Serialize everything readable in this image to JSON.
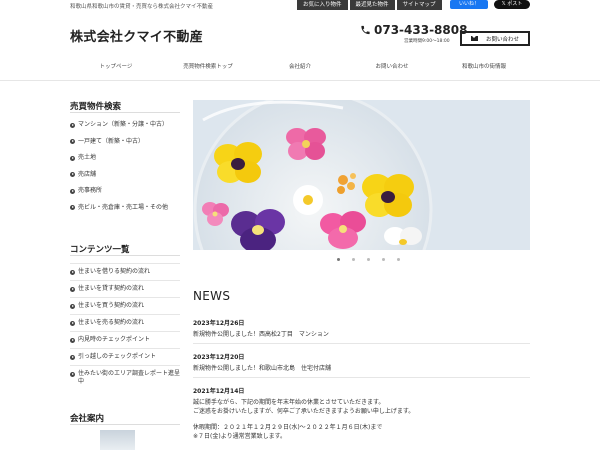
{
  "topbar": {
    "tagline": "和歌山県和歌山市の賃貸・売買なら株式会社クマイ不動産",
    "links": [
      "お気に入り物件",
      "最近見た物件",
      "サイトマップ"
    ],
    "fb_like": "いいね！",
    "x_post": "ポスト"
  },
  "header": {
    "site_title": "株式会社クマイ不動産",
    "phone": "073-433-8808",
    "hours": "営業時間9:00～18:00",
    "contact_label": "お問い合わせ"
  },
  "nav": {
    "items": [
      "トップページ",
      "売買物件検索トップ",
      "会社紹介",
      "お問い合わせ",
      "和歌山市の街情報"
    ]
  },
  "sidebar": {
    "search_heading": "売買物件検索",
    "categories": [
      "マンション（新築・分譲・中古）",
      "一戸建て（新築・中古）",
      "売土地",
      "売店舗",
      "売事務所",
      "売ビル・売倉庫・売工場・その他"
    ],
    "contents_heading": "コンテンツ一覧",
    "contents": [
      "住まいを借りる契約の流れ",
      "住まいを貸す契約の流れ",
      "住まいを買う契約の流れ",
      "住まいを売る契約の流れ",
      "内見時のチェックポイント",
      "引っ越しのチェックポイント",
      "住みたい街のエリア調査レポート進呈中"
    ],
    "company_heading": "会社案内"
  },
  "slider": {
    "slide_count": 5,
    "active_index": 0
  },
  "news": {
    "heading": "NEWS",
    "items": [
      {
        "date": "2023年12月26日",
        "lines": [
          "新規物件公開しました！西高松2丁目　マンション"
        ]
      },
      {
        "date": "2023年12月20日",
        "lines": [
          "新規物件公開しました！和歌山市北島　住宅付店舗"
        ]
      },
      {
        "date": "2021年12月14日",
        "lines": [
          "誠に勝手ながら、下記の期間を年末年始の休業とさせていただきます。",
          "ご迷惑をお掛けいたしますが、何卒ご了承いただきますようお願い申し上げます。",
          "休暇期間：２０２１年１２月２９日(水)～２０２２年１月６日(木)まで",
          "※７日(金)より通常営業致します。"
        ]
      }
    ]
  },
  "colors": {
    "dark_button": "#3a3a3a",
    "facebook": "#1877f2",
    "text": "#333333",
    "rule": "#e6e6e6"
  }
}
